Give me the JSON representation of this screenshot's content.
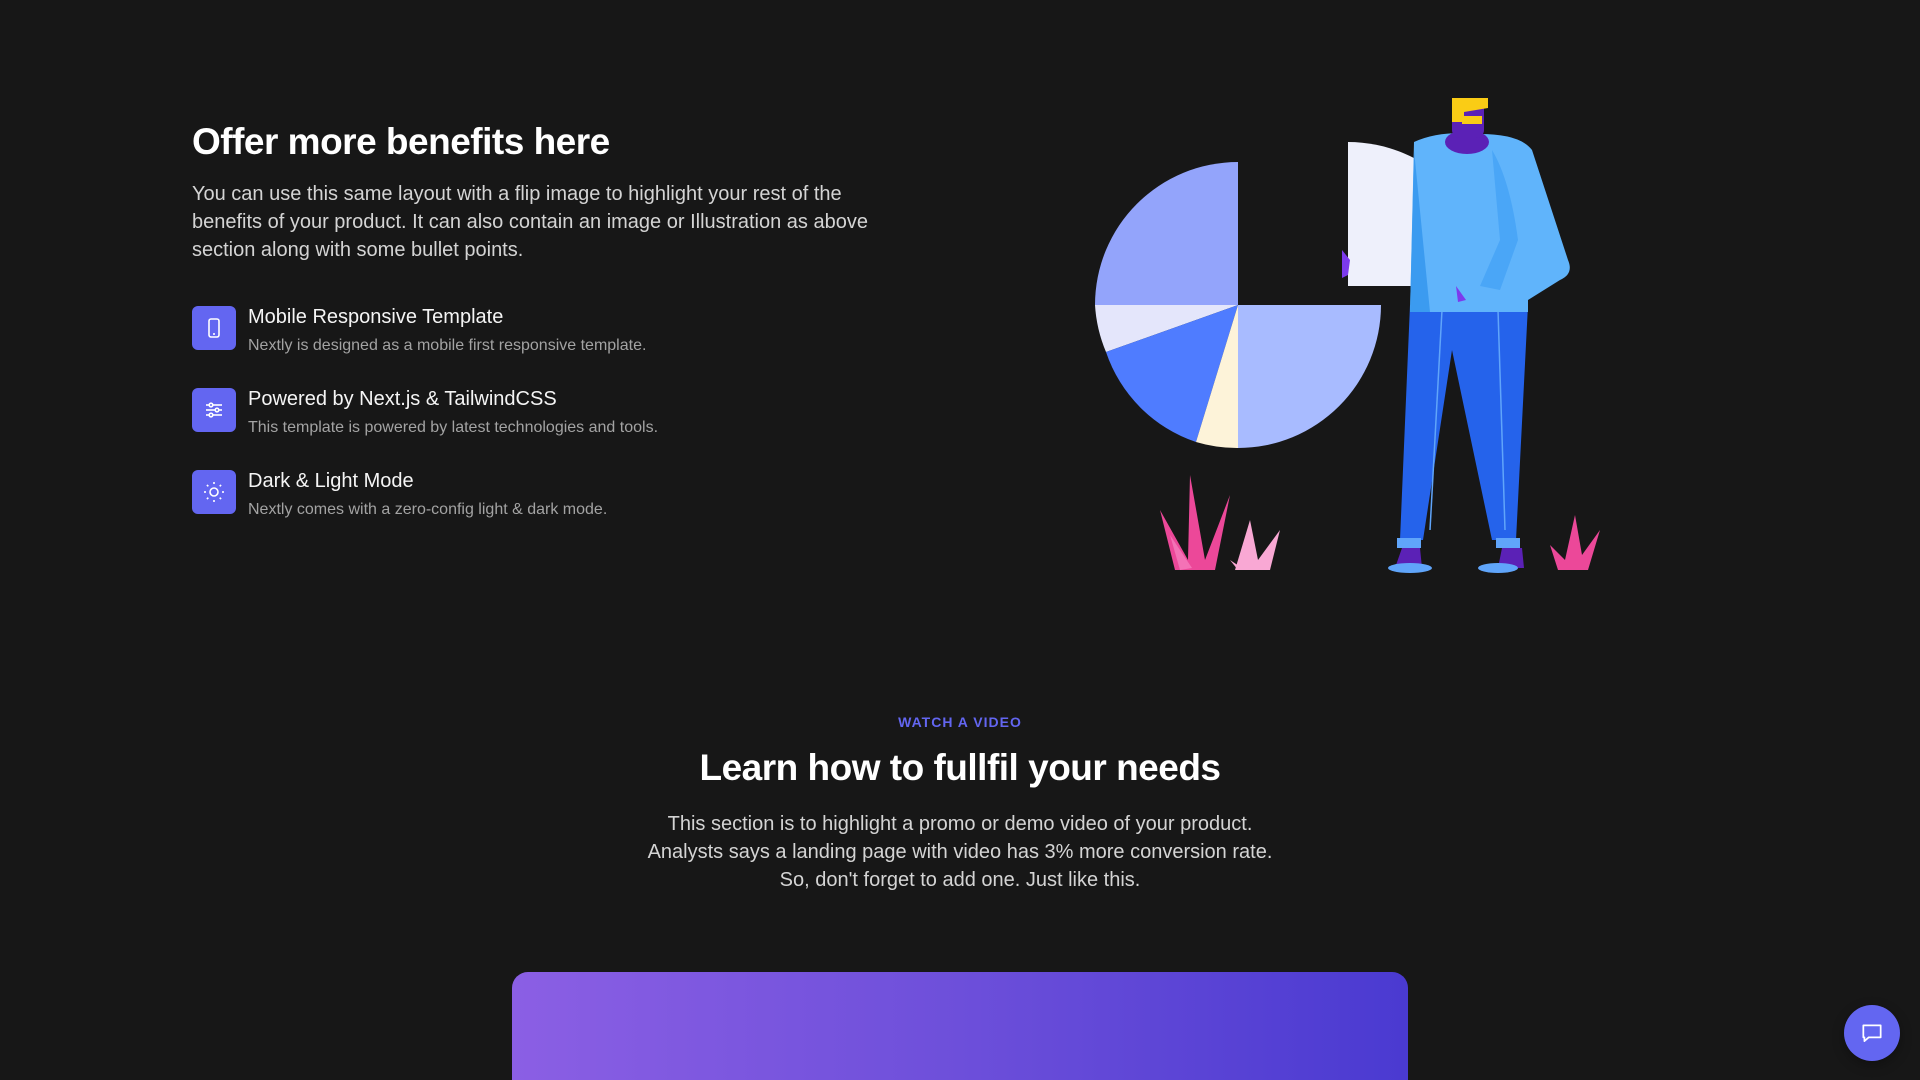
{
  "benefits": {
    "title": "Offer more benefits here",
    "description": "You can use this same layout with a flip image to highlight your rest of the benefits of your product. It can also contain an image or Illustration as above section along with some bullet points.",
    "items": [
      {
        "icon": "mobile-icon",
        "title": "Mobile Responsive Template",
        "desc": "Nextly is designed as a mobile first responsive template."
      },
      {
        "icon": "sliders-icon",
        "title": "Powered by Next.js & TailwindCSS",
        "desc": "This template is powered by latest technologies and tools."
      },
      {
        "icon": "sun-icon",
        "title": "Dark & Light Mode",
        "desc": "Nextly comes with a zero-config light & dark mode."
      }
    ]
  },
  "video_section": {
    "eyebrow": "Watch a video",
    "title": "Learn how to fullfil your needs",
    "description_lines": [
      "This section is to highlight a promo or demo video of your product.",
      "Analysts says a landing page with video has 3% more conversion rate.",
      "So, don't forget to add one. Just like this."
    ]
  },
  "colors": {
    "background": "#171717",
    "accent": "#6366f1",
    "video_gradient_start": "#8b5fe4",
    "video_gradient_end": "#4a3ad1"
  },
  "chat_button": {
    "icon": "chat-bubble-icon"
  }
}
